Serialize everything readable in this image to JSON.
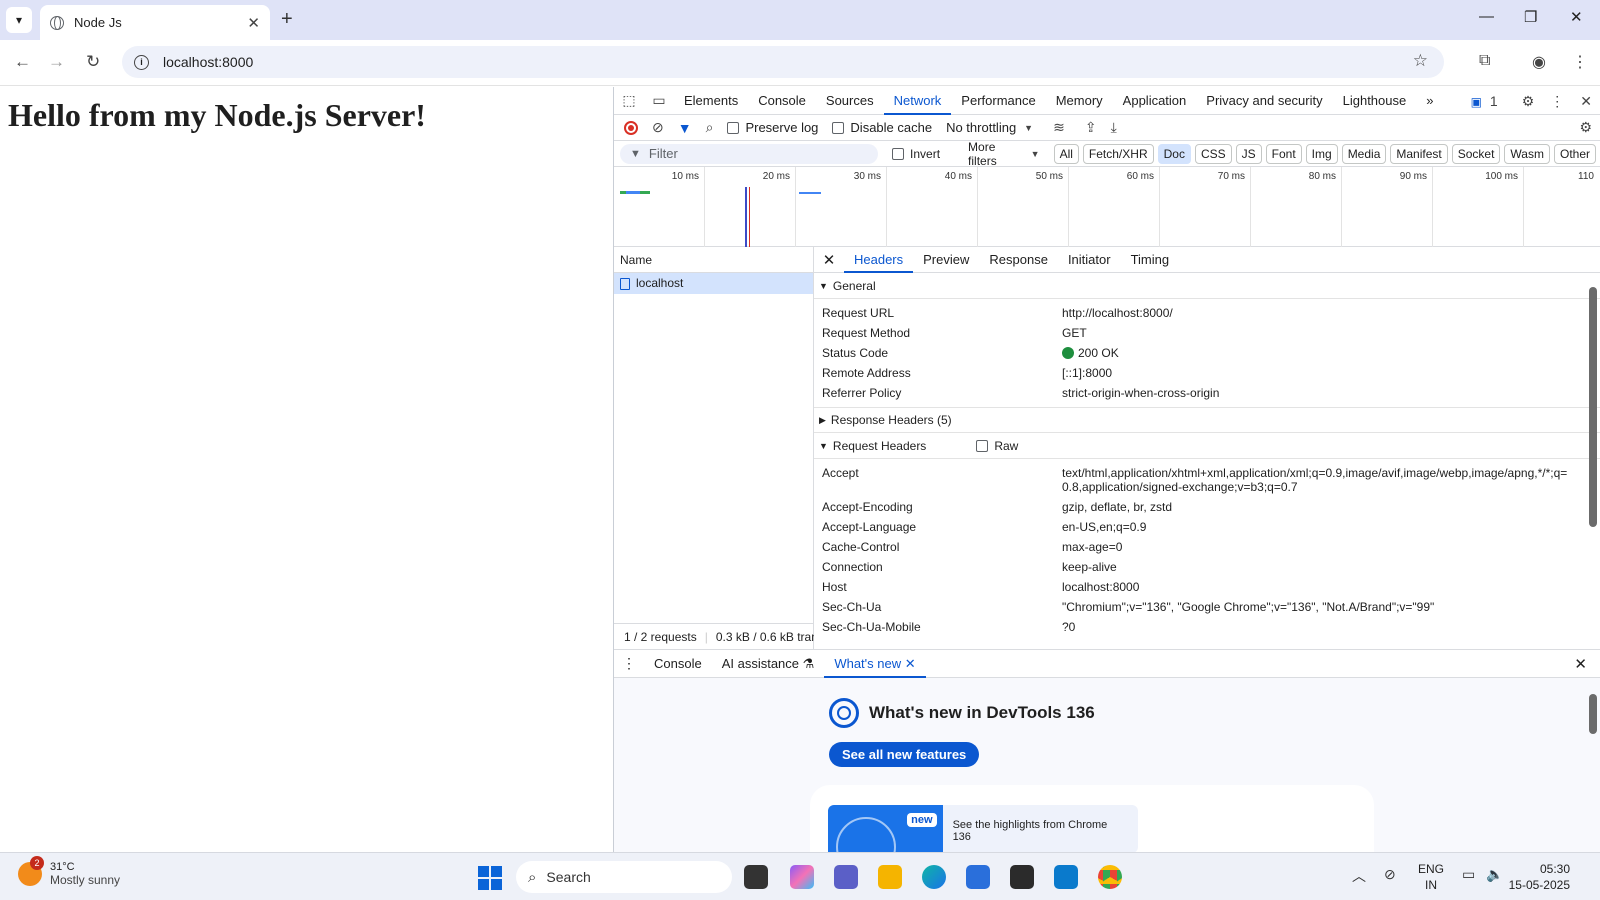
{
  "browser": {
    "tab_title": "Node Js",
    "url": "localhost:8000"
  },
  "page": {
    "heading": "Hello from my Node.js Server!"
  },
  "devtools": {
    "tabs": [
      "Elements",
      "Console",
      "Sources",
      "Network",
      "Performance",
      "Memory",
      "Application",
      "Privacy and security",
      "Lighthouse"
    ],
    "active_tab": "Network",
    "issues_count": "1",
    "toolbar": {
      "preserve_log": "Preserve log",
      "disable_cache": "Disable cache",
      "throttling": "No throttling"
    },
    "filter": {
      "placeholder": "Filter",
      "invert": "Invert",
      "more_filters": "More filters",
      "chips": [
        "All",
        "Fetch/XHR",
        "Doc",
        "CSS",
        "JS",
        "Font",
        "Img",
        "Media",
        "Manifest",
        "Socket",
        "Wasm",
        "Other"
      ],
      "active_chip": "Doc"
    },
    "timeline_labels": [
      "10 ms",
      "20 ms",
      "30 ms",
      "40 ms",
      "50 ms",
      "60 ms",
      "70 ms",
      "80 ms",
      "90 ms",
      "100 ms",
      "110"
    ],
    "requests": {
      "header": "Name",
      "items": [
        "localhost"
      ],
      "status": "1 / 2 requests",
      "transfer": "0.3 kB / 0.6 kB tran"
    },
    "details": {
      "tabs": [
        "Headers",
        "Preview",
        "Response",
        "Initiator",
        "Timing"
      ],
      "general_title": "General",
      "general": [
        {
          "k": "Request URL",
          "v": "http://localhost:8000/"
        },
        {
          "k": "Request Method",
          "v": "GET"
        },
        {
          "k": "Status Code",
          "v": "200 OK"
        },
        {
          "k": "Remote Address",
          "v": "[::1]:8000"
        },
        {
          "k": "Referrer Policy",
          "v": "strict-origin-when-cross-origin"
        }
      ],
      "response_headers_title": "Response Headers (5)",
      "request_headers_title": "Request Headers",
      "raw_label": "Raw",
      "request_headers": [
        {
          "k": "Accept",
          "v": "text/html,application/xhtml+xml,application/xml;q=0.9,image/avif,image/webp,image/apng,*/*;q=0.8,application/signed-exchange;v=b3;q=0.7"
        },
        {
          "k": "Accept-Encoding",
          "v": "gzip, deflate, br, zstd"
        },
        {
          "k": "Accept-Language",
          "v": "en-US,en;q=0.9"
        },
        {
          "k": "Cache-Control",
          "v": "max-age=0"
        },
        {
          "k": "Connection",
          "v": "keep-alive"
        },
        {
          "k": "Host",
          "v": "localhost:8000"
        },
        {
          "k": "Sec-Ch-Ua",
          "v": "\"Chromium\";v=\"136\", \"Google Chrome\";v=\"136\", \"Not.A/Brand\";v=\"99\""
        },
        {
          "k": "Sec-Ch-Ua-Mobile",
          "v": "?0"
        }
      ]
    },
    "drawer": {
      "tabs": [
        "Console",
        "AI assistance",
        "What's new"
      ],
      "whats_new_title": "What's new in DevTools 136",
      "see_all_button": "See all new features",
      "badge_new": "new",
      "highlights_text": "See the highlights from Chrome 136"
    }
  },
  "taskbar": {
    "weather_temp": "31°C",
    "weather_desc": "Mostly sunny",
    "weather_badge": "2",
    "search_placeholder": "Search",
    "lang_line1": "ENG",
    "lang_line2": "IN",
    "time": "05:30",
    "date": "15-05-2025"
  }
}
